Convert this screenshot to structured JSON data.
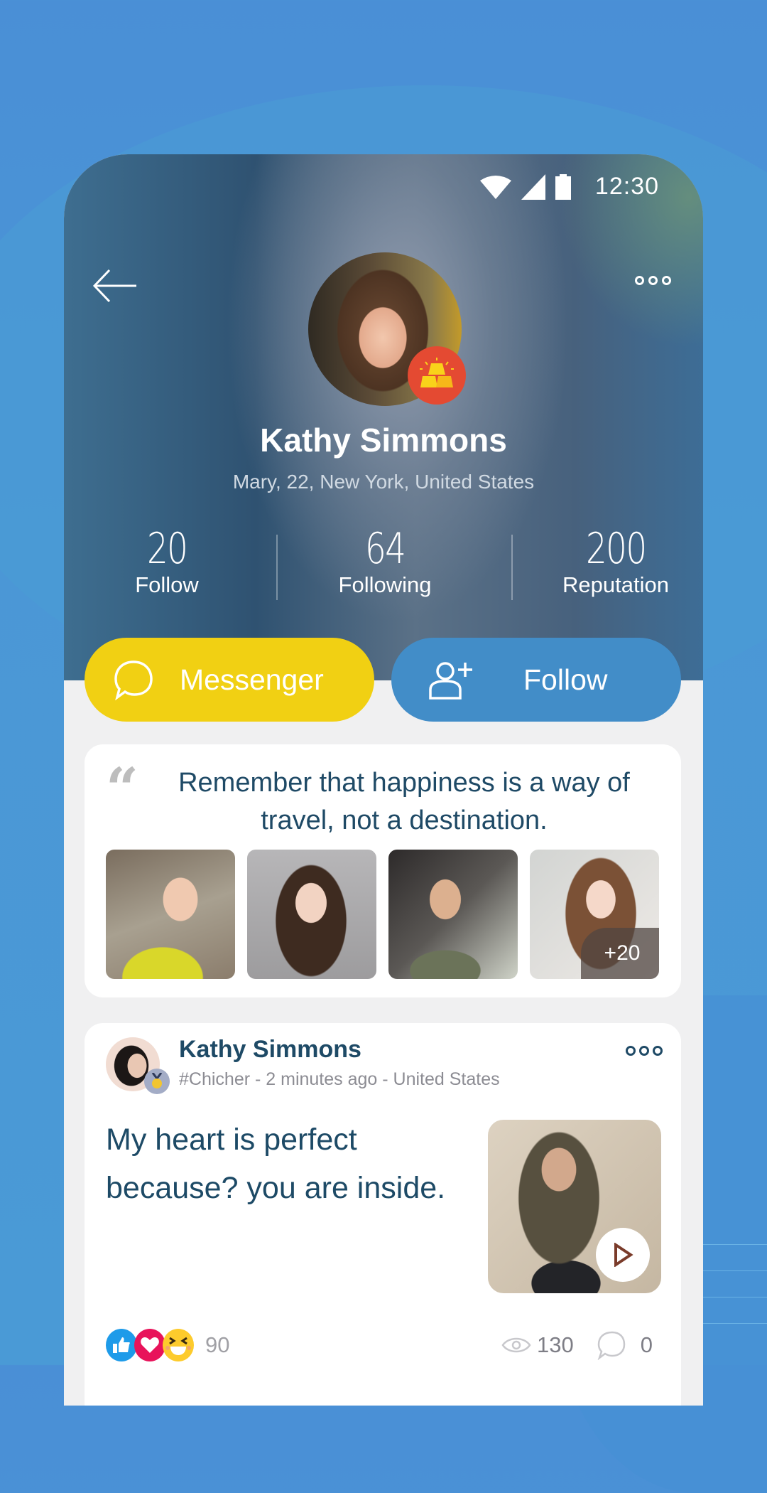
{
  "status_bar": {
    "time": "12:30",
    "icons": [
      "wifi-icon",
      "cellular-signal-icon",
      "battery-icon"
    ]
  },
  "header": {
    "back_icon": "arrow-left-icon",
    "more_icon": "more-horizontal-icon"
  },
  "profile": {
    "name": "Kathy Simmons",
    "subtitle": "Mary, 22, New York, United States",
    "badge_icon": "gold-bars-icon",
    "stats": [
      {
        "value": "20",
        "label": "Follow"
      },
      {
        "value": "64",
        "label": "Following"
      },
      {
        "value": "200",
        "label": "Reputation"
      }
    ]
  },
  "actions": {
    "messenger": {
      "label": "Messenger",
      "icon": "chat-bubble-icon",
      "color": "#f1d013"
    },
    "follow": {
      "label": "Follow",
      "icon": "add-user-icon",
      "color": "#428dc8"
    }
  },
  "quote_card": {
    "quote_icon": "quote-icon",
    "text": "Remember that happiness is a way of travel, not a destination.",
    "photos_more_count": "+20"
  },
  "post": {
    "author": "Kathy Simmons",
    "meta": "#Chicher - 2 minutes ago - United States",
    "text": "My heart is perfect because? you are inside.",
    "reactions": [
      "like-icon",
      "love-icon",
      "laugh-icon"
    ],
    "reaction_count": "90",
    "views": "130",
    "comments": "0"
  },
  "colors": {
    "primary_text": "#1e4a66",
    "background": "#4a8fd6"
  }
}
